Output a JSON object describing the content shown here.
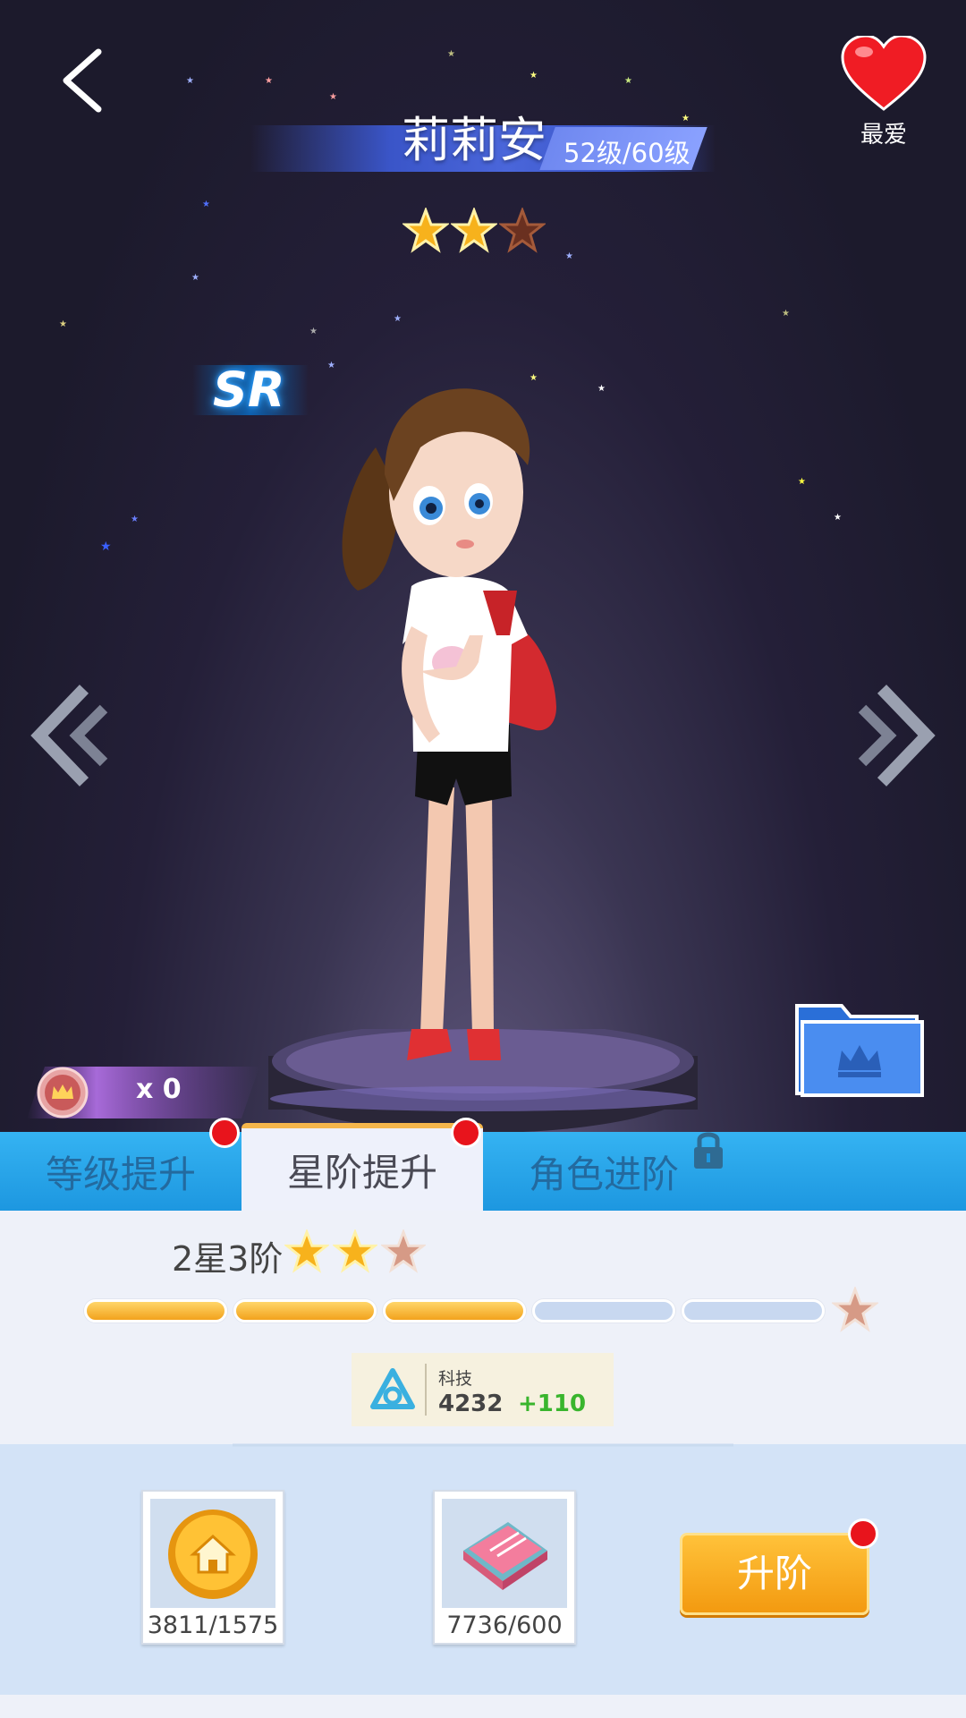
{
  "header": {
    "character_name": "莉莉安",
    "level_text": "52级/60级",
    "favorite_label": "最爱",
    "rarity": "SR",
    "star_rating": 2,
    "star_max": 3
  },
  "medal": {
    "count_text": "x 0"
  },
  "tabs": [
    {
      "label": "等级提升",
      "active": false,
      "badge": true
    },
    {
      "label": "星阶提升",
      "active": true,
      "badge": true
    },
    {
      "label": "角色进阶",
      "active": false,
      "locked": true
    }
  ],
  "star_rank": {
    "label": "2星3阶",
    "stars_filled": 2,
    "stars_total": 3,
    "progress_filled": 3,
    "progress_total": 5
  },
  "tech": {
    "name": "科技",
    "value": "4232",
    "bonus": "+110"
  },
  "materials": [
    {
      "icon": "coin-house-icon",
      "count": "3811/1575"
    },
    {
      "icon": "book-icon",
      "count": "7736/600"
    }
  ],
  "actions": {
    "upgrade_label": "升阶"
  },
  "colors": {
    "tab_bar": "#1d97e0",
    "button": "#f39a10",
    "badge": "#e8141c",
    "tech_plus": "#39b52d"
  }
}
